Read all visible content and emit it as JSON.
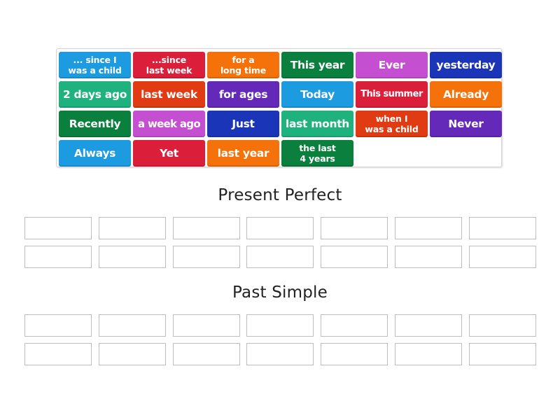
{
  "activity": {
    "type": "group sort",
    "tiles": [
      {
        "label": "... since I\nwas a child",
        "color": "#1d9be0",
        "lines": 2
      },
      {
        "label": "...since\nlast week",
        "color": "#db1f3a",
        "lines": 2
      },
      {
        "label": "for a\nlong time",
        "color": "#f47209",
        "lines": 2
      },
      {
        "label": "This year",
        "color": "#0b7f3e",
        "lines": 1
      },
      {
        "label": "Ever",
        "color": "#c44fd0",
        "lines": 1
      },
      {
        "label": "yesterday",
        "color": "#1a35b8",
        "lines": 1
      },
      {
        "label": "2 days ago",
        "color": "#1fb27e",
        "lines": 1
      },
      {
        "label": "last week",
        "color": "#e03b12",
        "lines": 1
      },
      {
        "label": "for ages",
        "color": "#6429b8",
        "lines": 1
      },
      {
        "label": "Today",
        "color": "#1d9be0",
        "lines": 1
      },
      {
        "label": "This summer",
        "color": "#db1f3a",
        "lines": 1,
        "tight": true
      },
      {
        "label": "Already",
        "color": "#f47209",
        "lines": 1
      },
      {
        "label": "Recently",
        "color": "#0b7f3e",
        "lines": 1
      },
      {
        "label": "a week ago",
        "color": "#c44fd0",
        "lines": 1,
        "wide": true
      },
      {
        "label": "Just",
        "color": "#1a35b8",
        "lines": 1
      },
      {
        "label": "last month",
        "color": "#1fb27e",
        "lines": 1
      },
      {
        "label": "when I\nwas a child",
        "color": "#e03b12",
        "lines": 2
      },
      {
        "label": "Never",
        "color": "#6429b8",
        "lines": 1
      },
      {
        "label": "Always",
        "color": "#1d9be0",
        "lines": 1
      },
      {
        "label": "Yet",
        "color": "#db1f3a",
        "lines": 1
      },
      {
        "label": "last year",
        "color": "#f47209",
        "lines": 1
      },
      {
        "label": "the last\n4 years",
        "color": "#0b7f3e",
        "lines": 2
      }
    ],
    "groups": [
      {
        "title": "Present Perfect",
        "slots": 14
      },
      {
        "title": "Past Simple",
        "slots": 14
      }
    ]
  }
}
